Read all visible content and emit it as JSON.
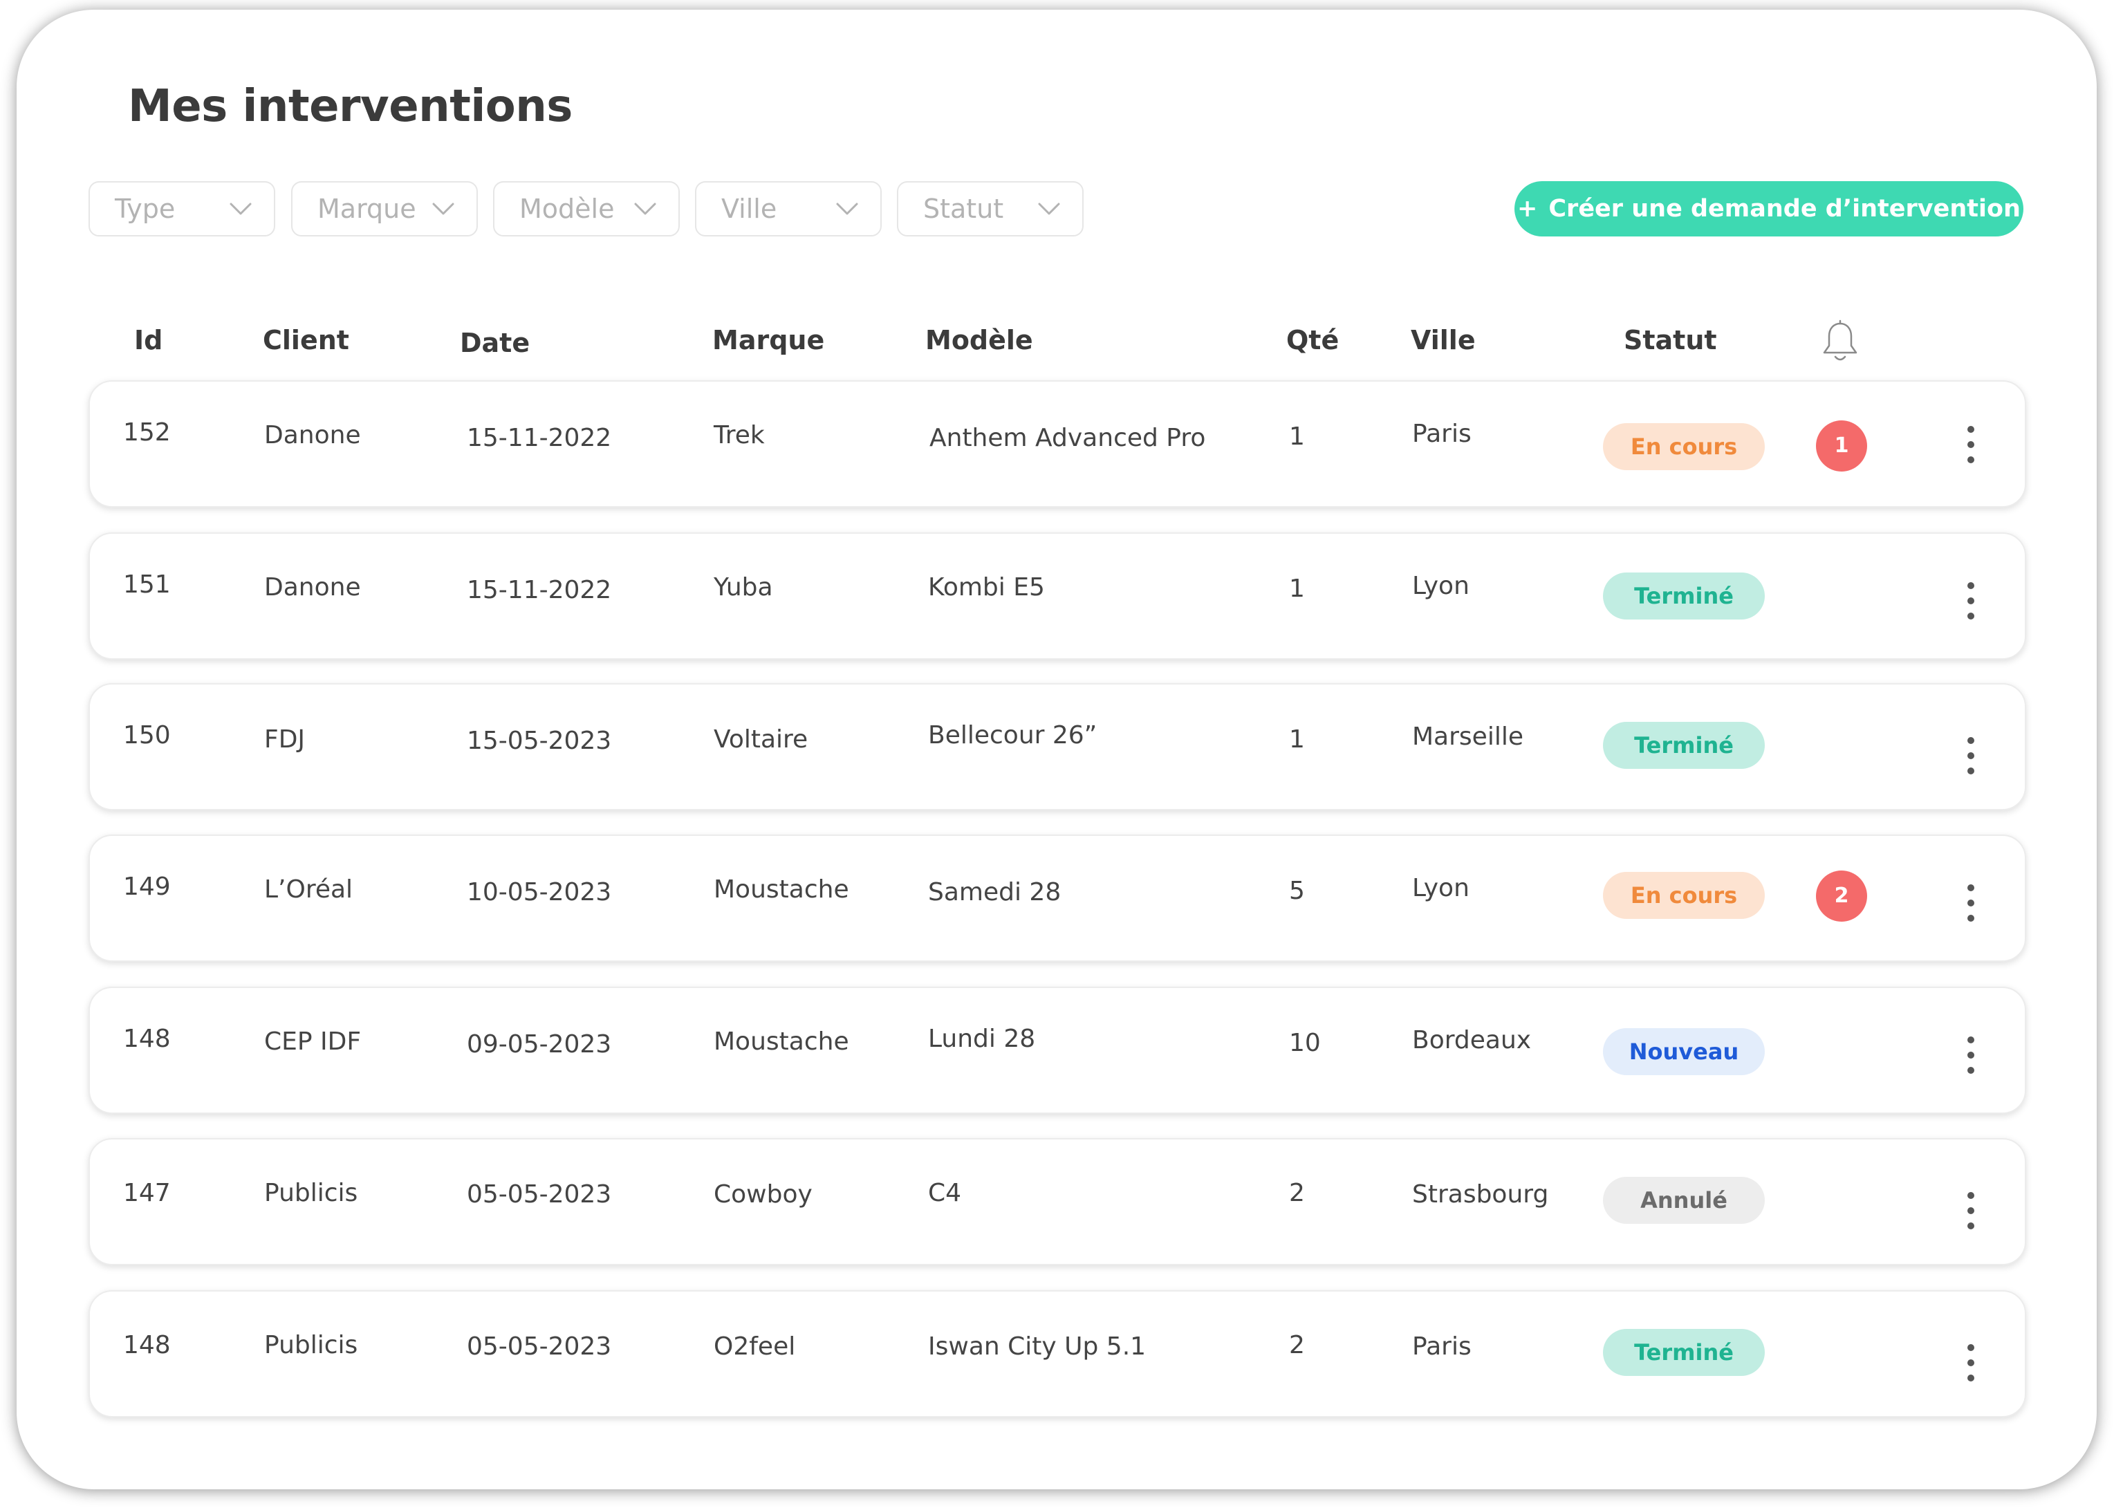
{
  "page": {
    "title": "Mes interventions"
  },
  "filters": [
    {
      "label": "Type"
    },
    {
      "label": "Marque"
    },
    {
      "label": "Modèle"
    },
    {
      "label": "Ville"
    },
    {
      "label": "Statut"
    }
  ],
  "actions": {
    "create_plus": "+",
    "create_label": "Créer une demande d’intervention"
  },
  "table": {
    "columns": {
      "id": "Id",
      "client": "Client",
      "date": "Date",
      "marque": "Marque",
      "modele": "Modèle",
      "qte": "Qté",
      "ville": "Ville",
      "statut": "Statut",
      "notifications_icon": "bell-icon"
    },
    "rows": [
      {
        "id": "152",
        "client": "Danone",
        "date": "15-11-2022",
        "marque": "Trek",
        "modele": "Anthem Advanced Pro",
        "qte": "1",
        "ville": "Paris",
        "statut": "En cours",
        "notifications": "1"
      },
      {
        "id": "151",
        "client": "Danone",
        "date": "15-11-2022",
        "marque": "Yuba",
        "modele": "Kombi E5",
        "qte": "1",
        "ville": "Lyon",
        "statut": "Terminé",
        "notifications": null
      },
      {
        "id": "150",
        "client": "FDJ",
        "date": "15-05-2023",
        "marque": "Voltaire",
        "modele": "Bellecour 26”",
        "qte": "1",
        "ville": "Marseille",
        "statut": "Terminé",
        "notifications": null
      },
      {
        "id": "149",
        "client": "L’Oréal",
        "date": "10-05-2023",
        "marque": "Moustache",
        "modele": "Samedi 28",
        "qte": "5",
        "ville": "Lyon",
        "statut": "En cours",
        "notifications": "2"
      },
      {
        "id": "148",
        "client": "CEP IDF",
        "date": "09-05-2023",
        "marque": "Moustache",
        "modele": "Lundi 28",
        "qte": "10",
        "ville": "Bordeaux",
        "statut": "Nouveau",
        "notifications": null
      },
      {
        "id": "147",
        "client": "Publicis",
        "date": "05-05-2023",
        "marque": "Cowboy",
        "modele": "C4",
        "qte": "2",
        "ville": "Strasbourg",
        "statut": "Annulé",
        "notifications": null
      },
      {
        "id": "148",
        "client": "Publicis",
        "date": "05-05-2023",
        "marque": "O2feel",
        "modele": "Iswan City Up 5.1",
        "qte": "2",
        "ville": "Paris",
        "statut": "Terminé",
        "notifications": null
      }
    ],
    "row_menu_icon": "more-vertical-icon"
  },
  "colors": {
    "accent": "#3ed9b2",
    "notification": "#f46a6a",
    "status": {
      "En cours": {
        "bg": "#fde3d1",
        "fg": "#f08a3c"
      },
      "Terminé": {
        "bg": "#c1ede2",
        "fg": "#1fb391"
      },
      "Nouveau": {
        "bg": "#e3edfb",
        "fg": "#1f5bd8"
      },
      "Annulé": {
        "bg": "#ededed",
        "fg": "#6b6b6b"
      }
    }
  }
}
